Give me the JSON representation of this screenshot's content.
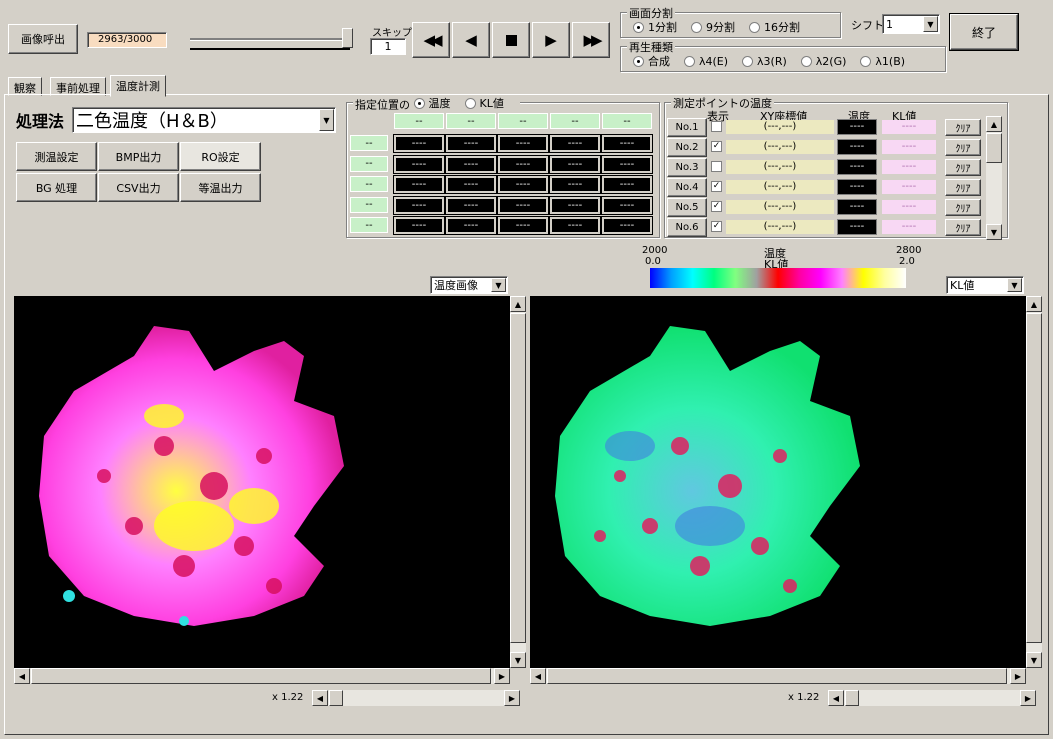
{
  "toolbar": {
    "load_label": "画像呼出",
    "frame_counter": "2963/3000",
    "skip_label": "スキップ",
    "skip_value": "1",
    "end_label": "終了",
    "playback_progress": 0.99
  },
  "screen_split": {
    "title": "画面分割",
    "options": [
      "1分割",
      "9分割",
      "16分割"
    ],
    "selected": "1分割"
  },
  "shift": {
    "label": "シフト",
    "value": "1"
  },
  "playback_type": {
    "title": "再生種類",
    "options": [
      "合成",
      "λ4(E)",
      "λ3(R)",
      "λ2(G)",
      "λ1(B)"
    ],
    "selected": "合成"
  },
  "tabs": [
    {
      "label": "観察"
    },
    {
      "label": "事前処理"
    },
    {
      "label": "温度計測",
      "active": true
    }
  ],
  "method": {
    "label": "処理法",
    "value": "二色温度（H＆B）"
  },
  "buttons": [
    [
      "測温設定",
      "BMP出力",
      "RO設定"
    ],
    [
      "BG 処理",
      "CSV出力",
      "等温出力"
    ]
  ],
  "position_panel": {
    "title": "指定位置の",
    "options": [
      "温度",
      "KL値"
    ],
    "selected": "温度",
    "col_headers": [
      "--",
      "--",
      "--",
      "--",
      "--"
    ],
    "row_headers": [
      "--",
      "--",
      "--",
      "--",
      "--"
    ],
    "cell_value": "----"
  },
  "measure_panel": {
    "title": "測定ポイントの温度",
    "headers": {
      "show": "表示",
      "xy": "XY座標値",
      "temp": "温度",
      "kl": "KL値"
    },
    "rows": [
      {
        "no": "No.1",
        "checked": false,
        "xy": "(---,---)",
        "temp": "----",
        "kl": "----",
        "clear": "ｸﾘｱ"
      },
      {
        "no": "No.2",
        "checked": true,
        "xy": "(---,---)",
        "temp": "----",
        "kl": "----",
        "clear": "ｸﾘｱ"
      },
      {
        "no": "No.3",
        "checked": false,
        "xy": "(---,---)",
        "temp": "----",
        "kl": "----",
        "clear": "ｸﾘｱ"
      },
      {
        "no": "No.4",
        "checked": true,
        "xy": "(---,---)",
        "temp": "----",
        "kl": "----",
        "clear": "ｸﾘｱ"
      },
      {
        "no": "No.5",
        "checked": true,
        "xy": "(---,---)",
        "temp": "----",
        "kl": "----",
        "clear": "ｸﾘｱ"
      },
      {
        "no": "No.6",
        "checked": true,
        "xy": "(---,---)",
        "temp": "----",
        "kl": "----",
        "clear": "ｸﾘｱ"
      }
    ]
  },
  "color_scale": {
    "temp_min": "2000",
    "temp_max": "2800",
    "kl_min": "0.0",
    "kl_max": "2.0",
    "label_temp": "温度",
    "label_kl": "KL値"
  },
  "left_view": {
    "select": "温度画像",
    "zoom": "x 1.22"
  },
  "right_view": {
    "select": "KL値",
    "zoom": "x 1.22"
  },
  "colors": {
    "panel_bg": "#d4d0c8",
    "green_cell": "#c8f0c8",
    "xy_bg": "#ece9c0",
    "kl_bg": "#f8d8f4",
    "counter_bg": "#f8dcc0"
  }
}
